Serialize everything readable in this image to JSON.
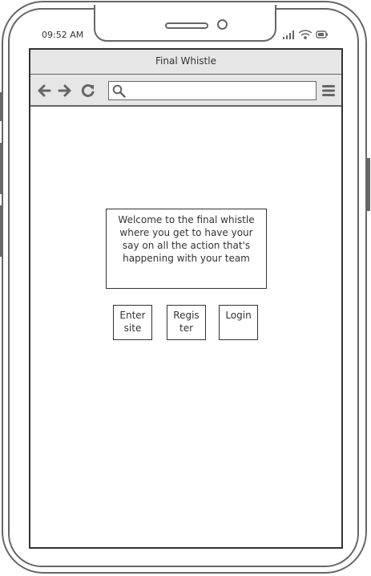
{
  "status_bar": {
    "time": "09:52 AM"
  },
  "browser": {
    "title": "Final Whistle",
    "url": "",
    "icons": [
      "back-arrow-icon",
      "forward-arrow-icon",
      "reload-icon",
      "search-icon",
      "hamburger-menu-icon"
    ]
  },
  "page": {
    "welcome_text": "Welcome to the final whistle where you get to have your say on all the action that's happening with your team",
    "buttons": {
      "enter_site": "Enter\nsite",
      "register": "Regis\nter",
      "login": "Login"
    }
  },
  "colors": {
    "outline": "#666666",
    "bar_background": "#e6e6e6",
    "text": "#333333"
  }
}
